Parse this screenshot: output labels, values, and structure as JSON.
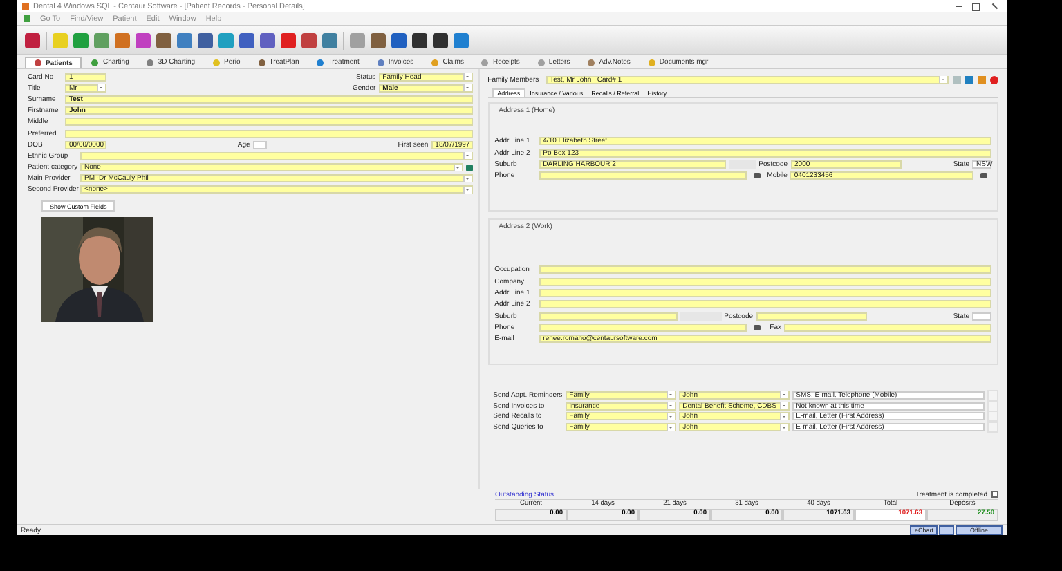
{
  "window": {
    "title": "Dental 4 Windows SQL - Centaur Software - [Patient Records - Personal Details]"
  },
  "menu": [
    "Go To",
    "Find/View",
    "Patient",
    "Edit",
    "Window",
    "Help"
  ],
  "module_tabs": [
    {
      "label": "Patients",
      "selected": true
    },
    {
      "label": "Charting",
      "selected": false
    },
    {
      "label": "3D Charting",
      "selected": false
    },
    {
      "label": "Perio",
      "selected": false
    },
    {
      "label": "TreatPlan",
      "selected": false
    },
    {
      "label": "Treatment",
      "selected": false
    },
    {
      "label": "Invoices",
      "selected": false
    },
    {
      "label": "Claims",
      "selected": false
    },
    {
      "label": "Receipts",
      "selected": false
    },
    {
      "label": "Letters",
      "selected": false
    },
    {
      "label": "Adv.Notes",
      "selected": false
    },
    {
      "label": "Documents mgr",
      "selected": false
    }
  ],
  "personal": {
    "card_no": {
      "label": "Card No",
      "value": "1"
    },
    "status": {
      "label": "Status",
      "value": "Family Head"
    },
    "title": {
      "label": "Title",
      "value": "Mr"
    },
    "gender": {
      "label": "Gender",
      "value": "Male"
    },
    "surname": {
      "label": "Surname",
      "value": "Test"
    },
    "firstname": {
      "label": "Firstname",
      "value": "John"
    },
    "middle": {
      "label": "Middle"
    },
    "preferred": {
      "label": "Preferred"
    },
    "dob": {
      "label": "DOB",
      "value": "00/00/0000"
    },
    "age": {
      "label": "Age"
    },
    "first_seen": {
      "label": "First seen",
      "value": "18/07/1997"
    },
    "ethnic_group": {
      "label": "Ethnic Group"
    },
    "patient_category": {
      "label": "Patient category",
      "value": "None"
    },
    "main_provider": {
      "label": "Main Provider",
      "value": "PM -Dr McCauly Phil"
    },
    "second_provider": {
      "label": "Second Provider",
      "value": "<none>"
    },
    "custom_fields_button": "Show Custom Fields"
  },
  "family_members": {
    "label": "Family Members",
    "value": "Test, Mr John   Card# 1"
  },
  "detail_tabs": [
    {
      "label": "Address",
      "selected": true
    },
    {
      "label": "Insurance / Various",
      "selected": false
    },
    {
      "label": "Recalls / Referral",
      "selected": false
    },
    {
      "label": "History",
      "selected": false
    }
  ],
  "address_1": {
    "heading": "Address 1 (Home)",
    "addr_line_1": {
      "label": "Addr Line 1",
      "value": "4/10 Elizabeth Street"
    },
    "addr_line_2": {
      "label": "Addr Line 2",
      "value": "Po Box 123"
    },
    "suburb": {
      "label": "Suburb",
      "value": "DARLING HARBOUR 2"
    },
    "postcode": {
      "label": "Postcode",
      "value": "2000"
    },
    "state": {
      "label": "State",
      "value": "NSW"
    },
    "phone": {
      "label": "Phone"
    },
    "mobile": {
      "label": "Mobile",
      "value": "0401233456"
    }
  },
  "address_2": {
    "heading": "Address 2 (Work)",
    "occupation": {
      "label": "Occupation"
    },
    "company": {
      "label": "Company"
    },
    "addr_line_1": {
      "label": "Addr Line 1"
    },
    "addr_line_2": {
      "label": "Addr Line 2"
    },
    "suburb": {
      "label": "Suburb"
    },
    "postcode": {
      "label": "Postcode"
    },
    "state": {
      "label": "State"
    },
    "phone": {
      "label": "Phone"
    },
    "fax": {
      "label": "Fax"
    },
    "email": {
      "label": "E-mail",
      "value": "renee.romano@centaursoftware.com"
    }
  },
  "send_rows": [
    {
      "label": "Send Appt. Reminders",
      "to": "Family",
      "name": "John",
      "method": "SMS, E-mail, Telephone (Mobile)"
    },
    {
      "label": "Send Invoices to",
      "to": "Insurance",
      "name": "Dental Benefit Scheme, CDBS",
      "method": "Not known at this time"
    },
    {
      "label": "Send Recalls to",
      "to": "Family",
      "name": "John",
      "method": "E-mail, Letter (First Address)"
    },
    {
      "label": "Send Queries to",
      "to": "Family",
      "name": "John",
      "method": "E-mail, Letter (First Address)"
    }
  ],
  "outstanding": {
    "title": "Outstanding Status",
    "treatment_completed": {
      "label": "Treatment is completed",
      "checked": false
    },
    "columns": [
      {
        "label": "Current",
        "value": "0.00",
        "color": "#000000"
      },
      {
        "label": "14 days",
        "value": "0.00",
        "color": "#000000"
      },
      {
        "label": "21 days",
        "value": "0.00",
        "color": "#000000"
      },
      {
        "label": "31 days",
        "value": "0.00",
        "color": "#000000"
      },
      {
        "label": "40 days",
        "value": "1071.63",
        "color": "#000000"
      },
      {
        "label": "Total",
        "value": "1071.63",
        "color": "#e02020"
      },
      {
        "label": "Deposits",
        "value": "27.50",
        "color": "#209020"
      }
    ]
  },
  "status_bar": {
    "text": "Ready",
    "echart": "eChart",
    "offline": "Offline"
  }
}
